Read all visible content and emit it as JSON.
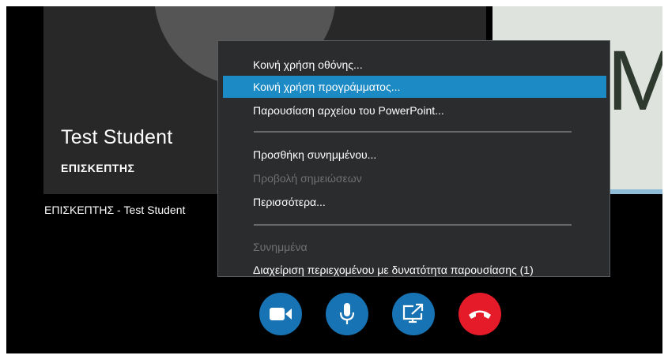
{
  "participant": {
    "name": "Test Student",
    "role": "ΕΠΙΣΚΕΠΤΗΣ",
    "caption": "ΕΠΙΣΚΕΠΤΗΣ - Test Student"
  },
  "slide_preview": {
    "visible_text": "M"
  },
  "share_menu": {
    "items": [
      {
        "label": "Κοινή χρήση οθόνης...",
        "state": "normal"
      },
      {
        "label": "Κοινή χρήση προγράμματος...",
        "state": "selected"
      },
      {
        "label": "Παρουσίαση αρχείου του PowerPoint...",
        "state": "normal"
      },
      {
        "label": "Προσθήκη συνημμένου...",
        "state": "normal"
      },
      {
        "label": "Προβολή σημειώσεων",
        "state": "disabled"
      },
      {
        "label": "Περισσότερα...",
        "state": "normal"
      },
      {
        "label": "Συνημμένα",
        "state": "disabled"
      },
      {
        "label": "Διαχείριση περιεχομένου με δυνατότητα παρουσίασης (1)",
        "state": "normal"
      }
    ]
  },
  "call_controls": [
    {
      "name": "video",
      "icon": "video-camera-icon"
    },
    {
      "name": "mic",
      "icon": "microphone-icon"
    },
    {
      "name": "share",
      "icon": "present-screen-icon"
    },
    {
      "name": "hangup",
      "icon": "hang-up-phone-icon"
    }
  ],
  "colors": {
    "menu_background": "#2b2c2e",
    "menu_selected": "#1c8ac4",
    "control_blue": "#1773b3",
    "control_red": "#e51b2a",
    "tile_background": "#282828"
  }
}
